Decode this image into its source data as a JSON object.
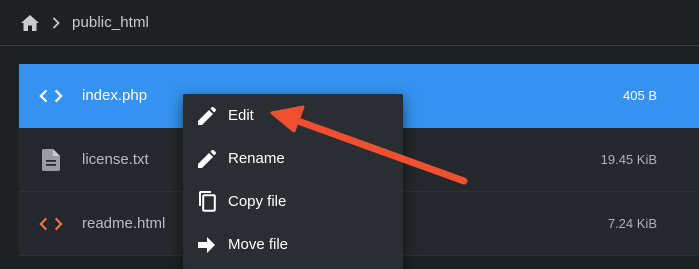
{
  "breadcrumb": {
    "home_icon": "home-icon",
    "separator_icon": "chevron-right-icon",
    "current": "public_html"
  },
  "files": [
    {
      "name": "index.php",
      "size": "405 B",
      "icon": "code-icon",
      "selected": true
    },
    {
      "name": "license.txt",
      "size": "19.45 KiB",
      "icon": "document-icon",
      "selected": false
    },
    {
      "name": "readme.html",
      "size": "7.24 KiB",
      "icon": "code-icon",
      "selected": false
    }
  ],
  "context_menu": {
    "items": [
      {
        "label": "Edit",
        "icon": "pencil-icon"
      },
      {
        "label": "Rename",
        "icon": "pencil-icon"
      },
      {
        "label": "Copy file",
        "icon": "copy-icon"
      },
      {
        "label": "Move file",
        "icon": "arrow-right-icon"
      }
    ]
  },
  "colors": {
    "background": "#1e2024",
    "row_background": "#24272b",
    "selected_row": "#3493f0",
    "menu_background": "#2a2d31",
    "annotation_arrow": "#f0502f",
    "html_icon": "#e8734f"
  }
}
